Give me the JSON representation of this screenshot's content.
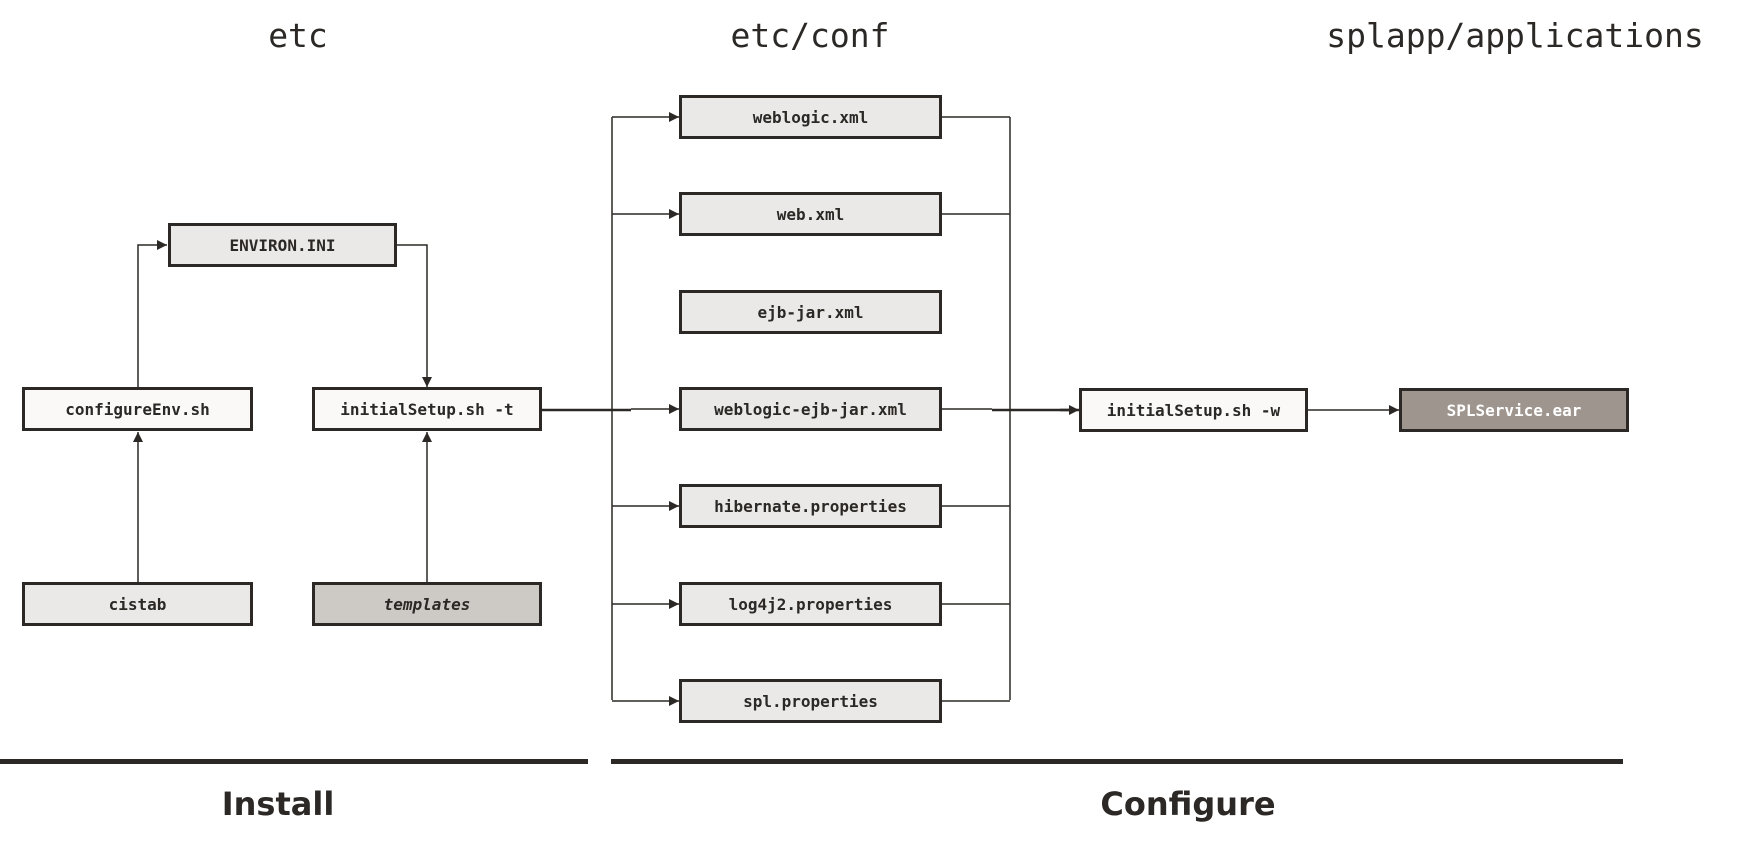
{
  "columns": {
    "etc": "etc",
    "etc_conf": "etc/conf",
    "splapp_applications": "splapp/applications"
  },
  "install": {
    "environ_ini": "ENVIRON.INI",
    "configure_env": "configureEnv.sh",
    "initial_setup_t": "initialSetup.sh -t",
    "cistab": "cistab",
    "templates": "templates"
  },
  "conf_files": [
    "weblogic.xml",
    "web.xml",
    "ejb-jar.xml",
    "weblogic-ejb-jar.xml",
    "hibernate.properties",
    "log4j2.properties",
    "spl.properties"
  ],
  "configure": {
    "initial_setup_w": "initialSetup.sh -w",
    "spl_service_ear": "SPLService.ear"
  },
  "phases": {
    "install": "Install",
    "configure": "Configure"
  },
  "colors": {
    "line": "#2b2825",
    "box_light": "#ebe9e7",
    "box_white": "#faf9f8",
    "box_template": "#cdc9c5",
    "box_output": "#9e958e"
  }
}
